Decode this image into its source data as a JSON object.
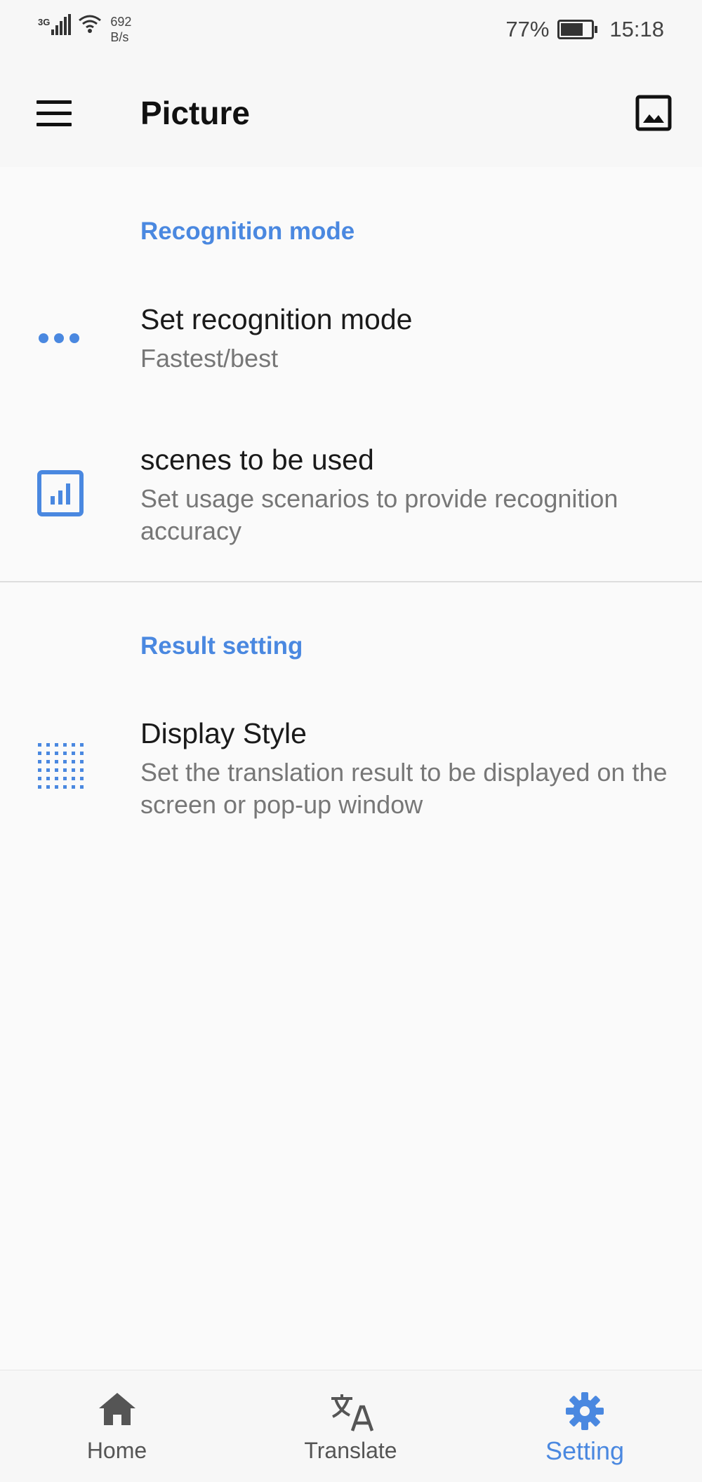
{
  "status_bar": {
    "network_type": "3G",
    "speed_value": "692",
    "speed_unit": "B/s",
    "battery": "77%",
    "battery_level": 0.77,
    "time": "15:18"
  },
  "app_bar": {
    "title": "Picture",
    "menu_icon": "hamburger-menu-icon",
    "action_icon": "image-icon"
  },
  "sections": [
    {
      "header": "Recognition mode",
      "items": [
        {
          "icon": "more-dots-icon",
          "title": "Set recognition mode",
          "subtitle": "Fastest/best"
        },
        {
          "icon": "bar-chart-icon",
          "title": "scenes to be used",
          "subtitle": "Set usage scenarios to provide recognition accuracy"
        }
      ]
    },
    {
      "header": "Result setting",
      "items": [
        {
          "icon": "dotted-grid-icon",
          "title": "Display Style",
          "subtitle": "Set the translation result to be displayed on the screen or pop-up window"
        }
      ]
    }
  ],
  "bottom_nav": {
    "items": [
      {
        "label": "Home",
        "icon": "home-icon"
      },
      {
        "label": "Translate",
        "icon": "translate-icon"
      },
      {
        "label": "Setting",
        "icon": "gear-icon"
      }
    ],
    "active": "Setting"
  },
  "colors": {
    "accent": "#4a88e0",
    "text_primary": "#1a1a1a",
    "text_secondary": "#777777",
    "background": "#fafafa"
  }
}
